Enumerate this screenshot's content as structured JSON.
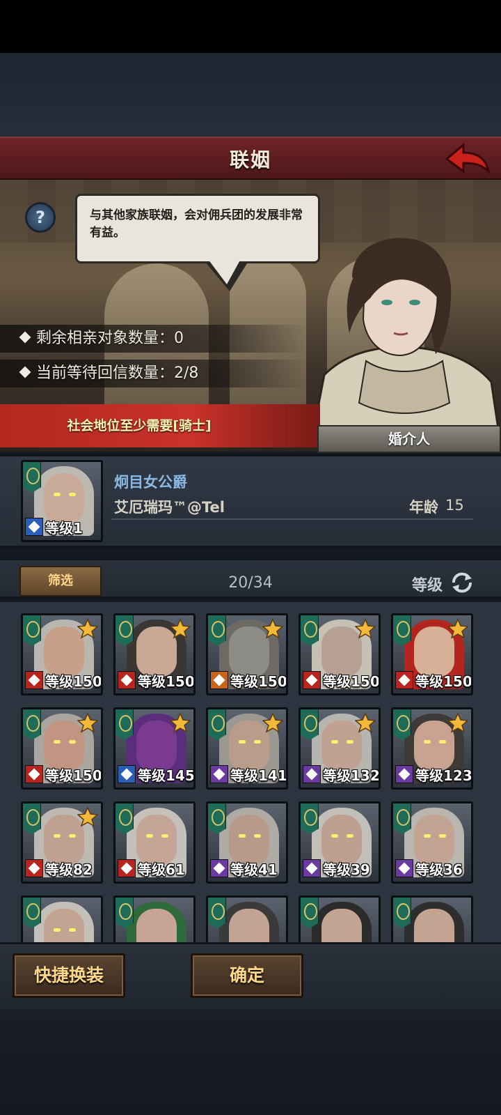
{
  "header": {
    "title": "联姻"
  },
  "scene": {
    "dialog": "与其他家族联姻，会对佣兵团的发展非常有益。",
    "stats": [
      {
        "label": "剩余相亲对象数量：0"
      },
      {
        "label": "当前等待回信数量：2/8"
      }
    ],
    "requirement": "社会地位至少需要[骑士]",
    "npc_label": "婚介人"
  },
  "selected": {
    "title": "炯目女公爵",
    "name": "艾厄瑞玛™@Tel",
    "age_label": "年龄",
    "age": "15",
    "level": "等级1",
    "class_color": "blue"
  },
  "filter": {
    "button": "筛选",
    "count": "20/34",
    "sort_label": "等级"
  },
  "units": [
    {
      "level": "等级150",
      "class": "red",
      "star": true,
      "hair": "#b9b6b0",
      "skin": "#c7a089",
      "eyes": false
    },
    {
      "level": "等级150",
      "class": "red",
      "star": true,
      "hair": "#3a3634",
      "skin": "#c9a896",
      "eyes": false
    },
    {
      "level": "等级150",
      "class": "orange",
      "star": true,
      "hair": "#6d6a63",
      "skin": "#8e8c86",
      "eyes": false
    },
    {
      "level": "等级150",
      "class": "red",
      "star": true,
      "hair": "#c6c1b5",
      "skin": "#b6a092",
      "eyes": false
    },
    {
      "level": "等级150",
      "class": "red",
      "star": true,
      "hair": "#b3261f",
      "skin": "#d6b197",
      "eyes": false
    },
    {
      "level": "等级150",
      "class": "red",
      "star": true,
      "hair": "#aaa69f",
      "skin": "#c19582",
      "eyes": true
    },
    {
      "level": "等级145",
      "class": "blue",
      "star": true,
      "hair": "#5a2e7a",
      "skin": "#7a3b8e",
      "eyes": false
    },
    {
      "level": "等级141",
      "class": "purple",
      "star": true,
      "hair": "#9b9891",
      "skin": "#b99c8a",
      "eyes": true
    },
    {
      "level": "等级132",
      "class": "purple",
      "star": true,
      "hair": "#b7b5b0",
      "skin": "#c1a292",
      "eyes": true
    },
    {
      "level": "等级123",
      "class": "purple",
      "star": true,
      "hair": "#3d3a38",
      "skin": "#c9a391",
      "eyes": true
    },
    {
      "level": "等级82",
      "class": "red",
      "star": true,
      "hair": "#bdbab3",
      "skin": "#c0a090",
      "eyes": true
    },
    {
      "level": "等级61",
      "class": "red",
      "star": false,
      "hair": "#c4c1ba",
      "skin": "#c5a696",
      "eyes": true
    },
    {
      "level": "等级41",
      "class": "purple",
      "star": false,
      "hair": "#aeaba4",
      "skin": "#b89a8a",
      "eyes": true
    },
    {
      "level": "等级39",
      "class": "purple",
      "star": false,
      "hair": "#c2bfb8",
      "skin": "#bf9f8f",
      "eyes": true
    },
    {
      "level": "等级36",
      "class": "purple",
      "star": false,
      "hair": "#b9b6af",
      "skin": "#c3a493",
      "eyes": true
    },
    {
      "level": "",
      "class": "",
      "star": false,
      "hair": "#c3c0b9",
      "skin": "#c3a493",
      "eyes": true
    },
    {
      "level": "",
      "class": "",
      "star": false,
      "hair": "#2e6a3a",
      "skin": "#c7a594",
      "eyes": false
    },
    {
      "level": "",
      "class": "",
      "star": false,
      "hair": "#3a3a3a",
      "skin": "#c3a493",
      "eyes": false
    },
    {
      "level": "",
      "class": "",
      "star": false,
      "hair": "#2b2b2b",
      "skin": "#c3a493",
      "eyes": false
    },
    {
      "level": "",
      "class": "",
      "star": false,
      "hair": "#2e2e2e",
      "skin": "#c3a493",
      "eyes": false
    }
  ],
  "buttons": {
    "quick_equip": "快捷换装",
    "confirm": "确定"
  },
  "colors": {
    "title_bar": "#5e1d20",
    "requirement_bar": "#c8322a",
    "button_text": "#ffd88a",
    "selected_title": "#8ab8e2"
  }
}
